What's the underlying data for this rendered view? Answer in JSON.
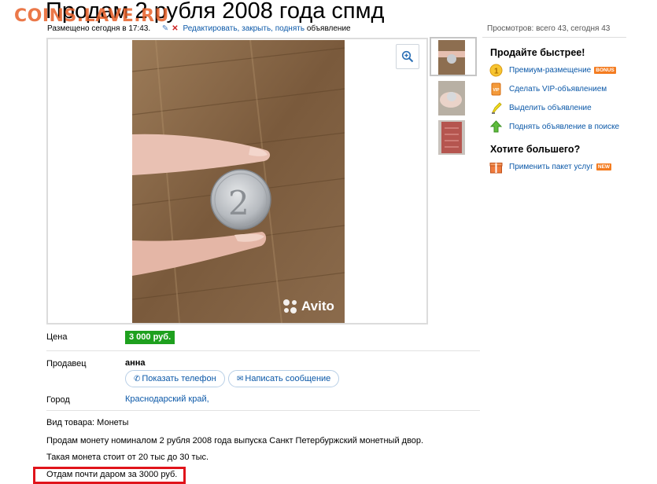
{
  "watermark": "COINS.LAVE.RU",
  "title": "Продам 2 рубля 2008 года спмд",
  "meta": {
    "posted": "Размещено сегодня в 17:43.",
    "edit_link": "Редактировать, закрыть, поднять",
    "edit_suffix": "объявление"
  },
  "views": "Просмотров: всего 43, сегодня 43",
  "photo": {
    "watermark": "Avito"
  },
  "details": {
    "price_label": "Цена",
    "price": "3 000 руб.",
    "seller_label": "Продавец",
    "seller_name": "анна",
    "show_phone": "Показать телефон",
    "write_message": "Написать сообщение",
    "city_label": "Город",
    "city": "Краснодарский край,"
  },
  "description": {
    "item_type": "Вид товара: Монеты",
    "line1": "Продам монету номиналом 2 рубля 2008 года выпуска Санкт Петербуржский монетный двор.",
    "line2": "Такая монета стоит от 20 тыс до 30 тыс.",
    "line3": "Отдам почти даром за 3000 руб."
  },
  "sidebar": {
    "sell_faster": "Продайте быстрее!",
    "items": [
      {
        "label": "Премиум-размещение",
        "badge": "BONUS",
        "icon": "premium-coin-icon",
        "badge_color": "#f47c20"
      },
      {
        "label": "Сделать VIP-объявлением",
        "icon": "vip-icon"
      },
      {
        "label": "Выделить объявление",
        "icon": "highlighter-icon"
      },
      {
        "label": "Поднять объявление в поиске",
        "icon": "raise-arrow-icon"
      }
    ],
    "want_more": "Хотите большего?",
    "package": {
      "label": "Применить пакет услуг",
      "badge": "NEW",
      "icon": "package-icon",
      "badge_color": "#f47c20"
    }
  },
  "colors": {
    "link": "#0b58a8",
    "price_bg": "#1ea01e",
    "highlight": "#e0141b"
  }
}
